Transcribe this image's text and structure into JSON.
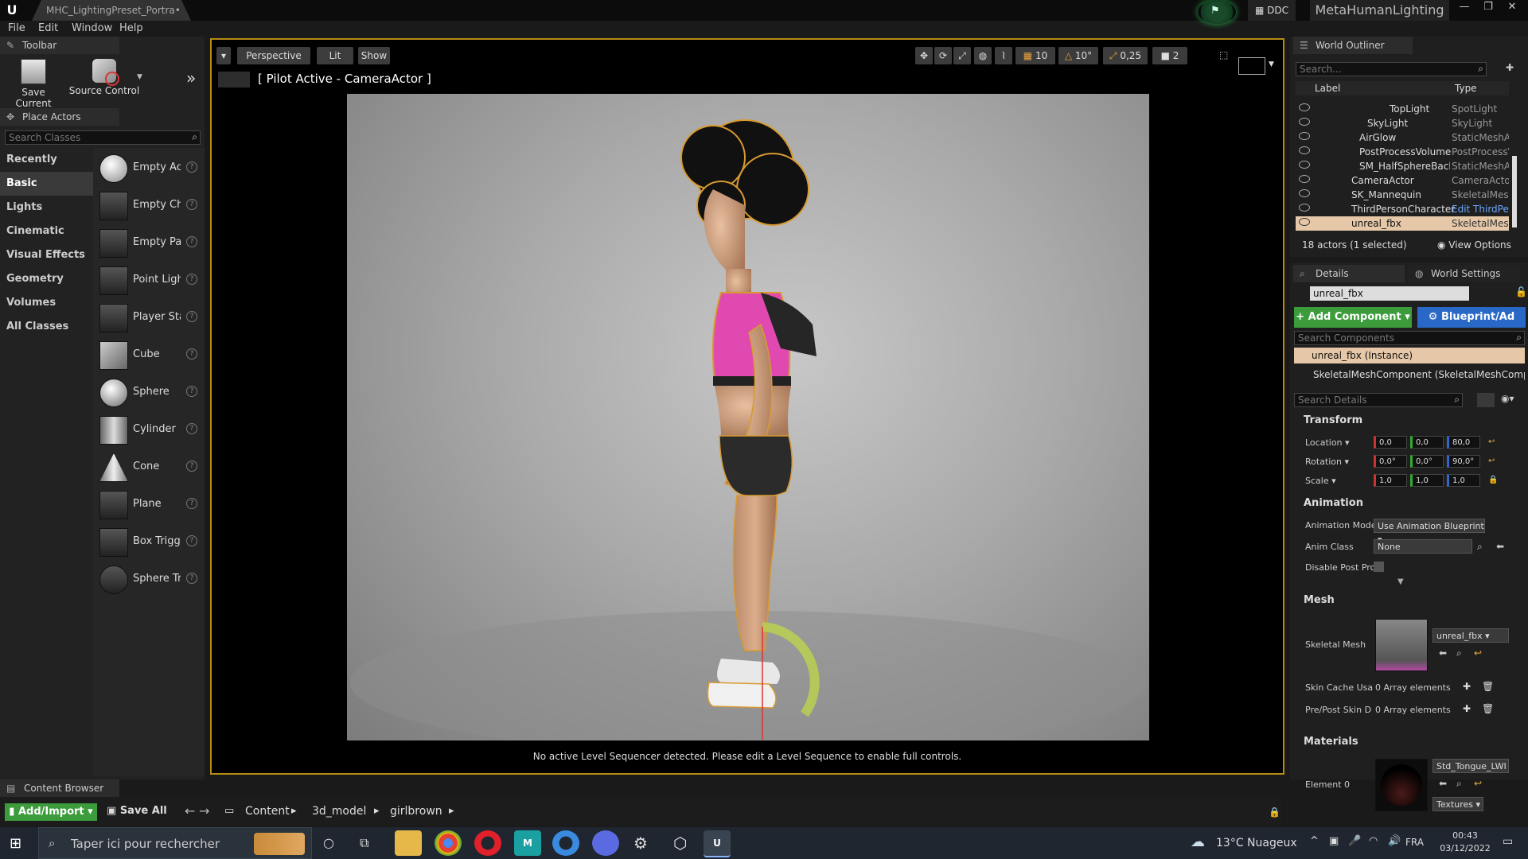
{
  "titlebar": {
    "doc_tab": "MHC_LightingPreset_Portra•",
    "ddc": "DDC",
    "project": "MetaHumanLighting"
  },
  "menu": [
    "File",
    "Edit",
    "Window",
    "Help"
  ],
  "toolbar": {
    "tab": "Toolbar",
    "save_current": "Save Current",
    "source_control": "Source Control"
  },
  "place_actors": {
    "tab": "Place Actors",
    "search_placeholder": "Search Classes",
    "categories": [
      "Recently Placed",
      "Basic",
      "Lights",
      "Cinematic",
      "Visual Effects",
      "Geometry",
      "Volumes",
      "All Classes"
    ],
    "actors": [
      "Empty Act",
      "Empty Cha",
      "Empty Pav",
      "Point Light",
      "Player Sta",
      "Cube",
      "Sphere",
      "Cylinder",
      "Cone",
      "Plane",
      "Box Trigge",
      "Sphere Tr"
    ]
  },
  "viewport": {
    "perspective": "Perspective",
    "lit": "Lit",
    "show": "Show",
    "pilot": "[ Pilot Active - CameraActor ]",
    "grid_snap": "10",
    "rot_snap": "10°",
    "scale_snap": "0,25",
    "cam_speed": "2",
    "sequencer_msg": "No active Level Sequencer detected. Please edit a Level Sequence to enable full controls."
  },
  "outliner": {
    "tab": "World Outliner",
    "search_placeholder": "Search...",
    "col_label": "Label",
    "col_type": "Type",
    "rows": [
      {
        "label": "TopLight",
        "type": "SpotLight"
      },
      {
        "label": "SkyLight",
        "type": "SkyLight"
      },
      {
        "label": "AirGlow",
        "type": "StaticMeshAc"
      },
      {
        "label": "PostProcessVolume",
        "type": "PostProcessV"
      },
      {
        "label": "SM_HalfSphereBackg",
        "type": "StaticMeshAc"
      },
      {
        "label": "CameraActor",
        "type": "CameraActor"
      },
      {
        "label": "SK_Mannequin",
        "type": "SkeletalMesh"
      },
      {
        "label": "ThirdPersonCharacter",
        "type": "Edit ThirdPe"
      },
      {
        "label": "unreal_fbx",
        "type": "SkeletalMesh"
      }
    ],
    "status": "18 actors (1 selected)",
    "view_options": "View Options"
  },
  "details": {
    "tab": "Details",
    "world_settings": "World Settings",
    "name": "unreal_fbx",
    "add_component": "+ Add Component",
    "blueprint": "Blueprint/Ad",
    "search_components": "Search Components",
    "instance": "unreal_fbx (Instance)",
    "component": "SkeletalMeshComponent (SkeletalMeshCompo",
    "search_details": "Search Details",
    "transform": {
      "title": "Transform",
      "location_label": "Location",
      "rotation_label": "Rotation",
      "scale_label": "Scale",
      "location": [
        "0,0",
        "0,0",
        "80,0"
      ],
      "rotation": [
        "0,0°",
        "0,0°",
        "90,0°"
      ],
      "scale": [
        "1,0",
        "1,0",
        "1,0"
      ]
    },
    "animation": {
      "title": "Animation",
      "mode_label": "Animation Mode",
      "mode_value": "Use Animation Blueprint",
      "class_label": "Anim Class",
      "class_value": "None",
      "disable_post": "Disable Post Prc"
    },
    "mesh": {
      "title": "Mesh",
      "skeletal_mesh_label": "Skeletal Mesh",
      "skeletal_mesh_value": "unreal_fbx",
      "skin_cache_label": "Skin Cache Usa",
      "skin_cache_value": "0 Array elements",
      "pre_post_label": "Pre/Post Skin D",
      "pre_post_value": "0 Array elements"
    },
    "materials": {
      "title": "Materials",
      "element_label": "Element 0",
      "element_value": "Std_Tongue_LWI",
      "textures": "Textures"
    }
  },
  "content_browser": {
    "tab": "Content Browser",
    "add_import": "Add/Import",
    "save_all": "Save All",
    "path": [
      "Content",
      "3d_model",
      "girlbrown"
    ]
  },
  "taskbar": {
    "search_placeholder": "Taper ici pour rechercher",
    "weather": "13°C Nuageux",
    "lang": "FRA",
    "time": "00:43",
    "date": "03/12/2022"
  }
}
